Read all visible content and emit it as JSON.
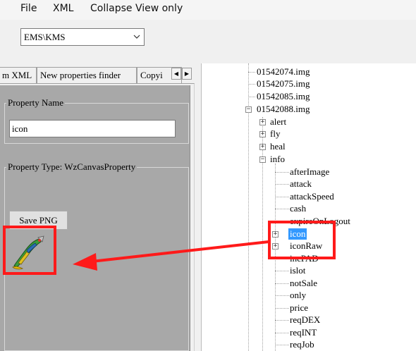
{
  "menu": {
    "file": "File",
    "xml": "XML",
    "collapse": "Collapse View only"
  },
  "combo": {
    "value": "EMS\\KMS"
  },
  "tabs": {
    "tab1": "m XML",
    "tab2": "New properties finder",
    "tab3": "Copyi"
  },
  "property": {
    "name_legend": "Property Name",
    "name_value": "icon",
    "type_legend": "Property Type: WzCanvasProperty",
    "save_label": "Save PNG"
  },
  "tree": {
    "nodes": [
      "01542074.img",
      "01542075.img",
      "01542085.img",
      "01542088.img",
      "alert",
      "fly",
      "heal",
      "info",
      "afterImage",
      "attack",
      "attackSpeed",
      "cash",
      "expireOnLogout",
      "icon",
      "iconRaw",
      "incPAD",
      "islot",
      "notSale",
      "only",
      "price",
      "reqDEX",
      "reqINT",
      "reqJob"
    ]
  },
  "colors": {
    "annotation": "#ff1a1a",
    "selection": "#3399ff"
  }
}
